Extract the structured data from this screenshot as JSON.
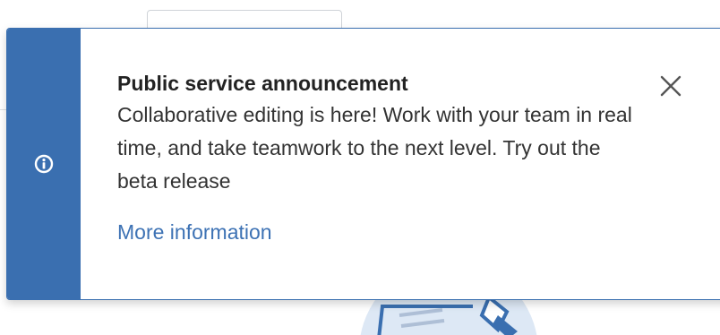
{
  "notification": {
    "title": "Public service announcement",
    "message": "Collaborative editing is here! Work with your team in real time, and take teamwork to the next level. Try out the beta release",
    "link_label": "More information",
    "icon": "info-icon",
    "close_icon": "close-icon"
  },
  "colors": {
    "accent": "#3a6fb0",
    "link": "#3d72b4",
    "title_text": "#222222",
    "body_text": "#333333"
  }
}
